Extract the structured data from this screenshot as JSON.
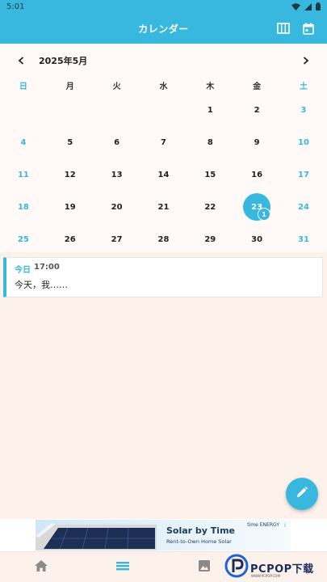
{
  "status_bar": {
    "time": "5:01"
  },
  "app_bar": {
    "title": "カレンダー"
  },
  "calendar": {
    "month_label": "2025年5月",
    "weekdays": [
      "日",
      "月",
      "火",
      "水",
      "木",
      "金",
      "土"
    ],
    "weeks": [
      [
        "",
        "",
        "",
        "",
        "1",
        "2",
        "3"
      ],
      [
        "4",
        "5",
        "6",
        "7",
        "8",
        "9",
        "10"
      ],
      [
        "11",
        "12",
        "13",
        "14",
        "15",
        "16",
        "17"
      ],
      [
        "18",
        "19",
        "20",
        "21",
        "22",
        "23",
        "24"
      ],
      [
        "25",
        "26",
        "27",
        "28",
        "29",
        "30",
        "31"
      ]
    ],
    "today": "23",
    "today_badge": "1"
  },
  "entry": {
    "day_label": "今日",
    "time": "17:00",
    "text": "今天，我……"
  },
  "ad": {
    "title": "Solar by Time",
    "subtitle": "Rent-to-Own Home Solar",
    "brand": "time ENERGY",
    "info": "i"
  },
  "watermark": {
    "text": "PCPOP下载",
    "sub": "WWW.PCPOP.COM"
  },
  "colors": {
    "accent": "#38b8de",
    "background": "#fdf1ec",
    "calendar_bg": "#fffaf8"
  },
  "icons": {
    "status": [
      "wifi-icon",
      "signal-icon",
      "battery-icon"
    ],
    "app_bar": [
      "view-columns-icon",
      "calendar-today-icon"
    ],
    "bottom_nav": [
      "home-icon",
      "list-icon",
      "image-icon"
    ],
    "fab": "pencil-icon"
  }
}
